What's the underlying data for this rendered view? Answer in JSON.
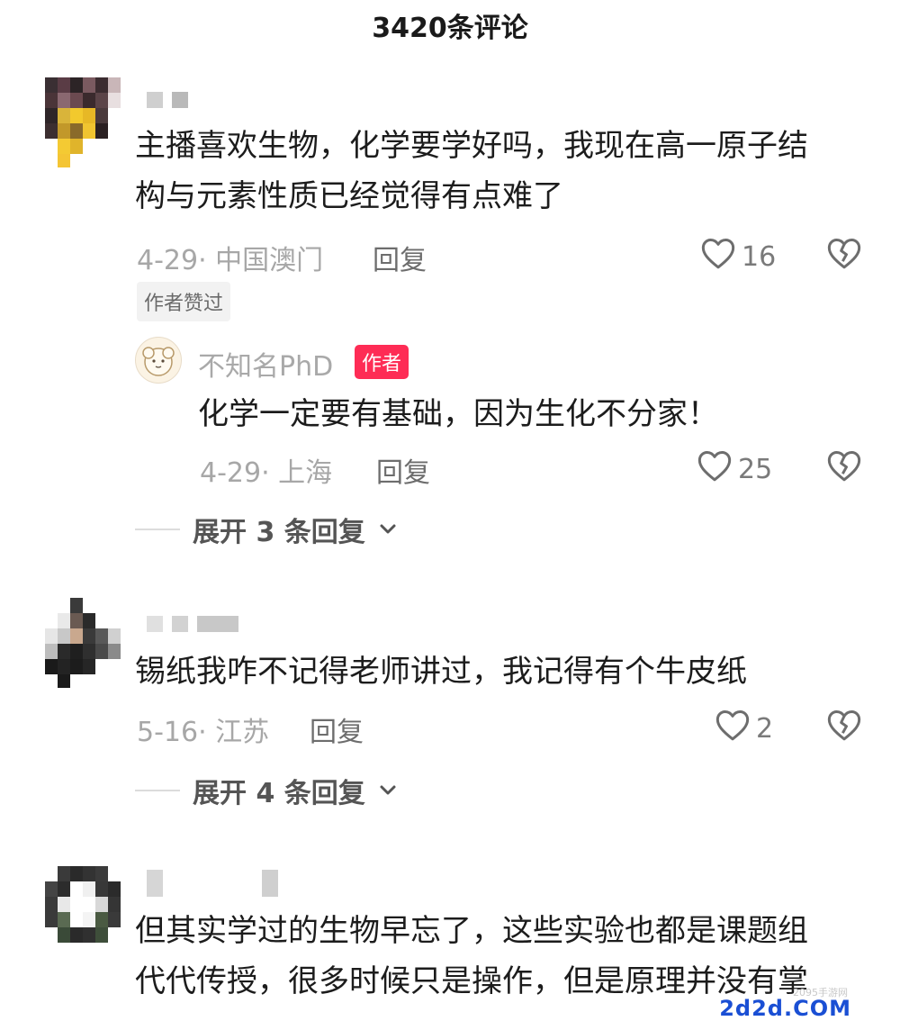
{
  "header": {
    "title": "3420条评论"
  },
  "comments": [
    {
      "text_lines": [
        "主播喜欢生物，化学要学好吗，我现在高一原子结",
        "构与元素性质已经觉得有点难了"
      ],
      "date_location": "4-29· 中国澳门",
      "reply_label": "回复",
      "likes": "16",
      "tag": "作者赞过",
      "author_reply": {
        "name": "不知名PhD",
        "badge": "作者",
        "text": "化学一定要有基础，因为生化不分家！",
        "date_location": "4-29· 上海",
        "reply_label": "回复",
        "likes": "25"
      },
      "expand_label": "展开 3 条回复"
    },
    {
      "text_lines": [
        "锡纸我咋不记得老师讲过，我记得有个牛皮纸"
      ],
      "date_location": "5-16· 江苏",
      "reply_label": "回复",
      "likes": "2",
      "expand_label": "展开 4 条回复"
    },
    {
      "text_lines": [
        "但其实学过的生物早忘了，这些实验也都是课题组",
        "代代传授，很多时候只是操作，但是原理并没有掌"
      ]
    }
  ],
  "watermark": {
    "brand": "2d2d.COM",
    "small": "2095手游网"
  },
  "icons": {
    "like": "heart-outline-icon",
    "dislike": "broken-heart-icon",
    "expand": "chevron-down-icon"
  }
}
